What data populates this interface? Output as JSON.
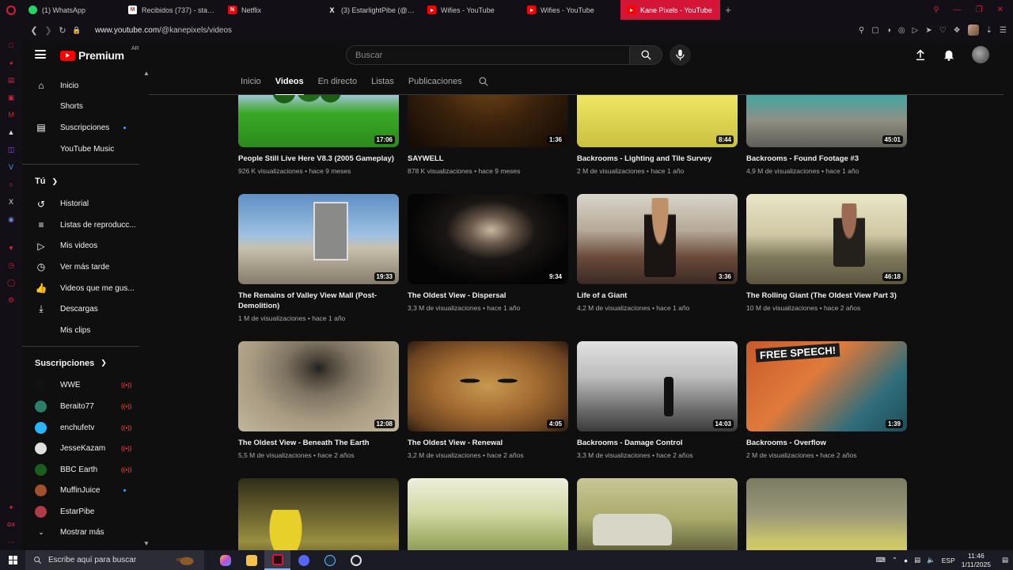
{
  "browser": {
    "tabs": [
      {
        "title": "(1) WhatsApp",
        "favicon": "whatsapp-icon"
      },
      {
        "title": "Recibidos (737) - starlight",
        "favicon": "gmail-icon"
      },
      {
        "title": "Netflix",
        "favicon": "netflix-icon"
      },
      {
        "title": "(3) EstarlightPibe (@Esta",
        "favicon": "x-icon"
      },
      {
        "title": "Wifies - YouTube",
        "favicon": "youtube-icon"
      },
      {
        "title": "Wifies - YouTube",
        "favicon": "youtube-icon"
      },
      {
        "title": "Kane Pixels - YouTube",
        "favicon": "youtube-icon",
        "active": true
      }
    ],
    "url_host": "www.youtube.com",
    "url_path": "/@kanepixels/videos",
    "accent": "#d31638"
  },
  "masthead": {
    "logo_text": "Premium",
    "country_code": "AR",
    "search_placeholder": "Buscar"
  },
  "guide": {
    "main": [
      {
        "label": "Inicio",
        "icon": "home-icon"
      },
      {
        "label": "Shorts",
        "icon": "shorts-icon"
      },
      {
        "label": "Suscripciones",
        "icon": "subscriptions-icon",
        "dot": true
      },
      {
        "label": "YouTube Music",
        "icon": "music-icon"
      }
    ],
    "you_title": "Tú",
    "you": [
      {
        "label": "Historial",
        "icon": "history-icon"
      },
      {
        "label": "Listas de reproducc...",
        "icon": "playlists-icon"
      },
      {
        "label": "Mis videos",
        "icon": "my-videos-icon"
      },
      {
        "label": "Ver más tarde",
        "icon": "watch-later-icon"
      },
      {
        "label": "Videos que me gus...",
        "icon": "liked-icon"
      },
      {
        "label": "Descargas",
        "icon": "download-icon"
      },
      {
        "label": "Mis clips",
        "icon": "clips-icon"
      }
    ],
    "subs_title": "Suscripciones",
    "subs": [
      {
        "label": "WWE",
        "color": "#111111",
        "live": true
      },
      {
        "label": "Beraito77",
        "color": "#2e7d6a",
        "live": true
      },
      {
        "label": "enchufetv",
        "color": "#29b6f6",
        "live": true
      },
      {
        "label": "JesseKazam",
        "color": "#e0e0e0",
        "live": true
      },
      {
        "label": "BBC Earth",
        "color": "#1b5e20",
        "live": true
      },
      {
        "label": "MuffinJuice",
        "color": "#a1502c",
        "dot": true
      },
      {
        "label": "EstarPibe",
        "color": "#b03a48"
      }
    ],
    "show_more": "Mostrar más"
  },
  "channel_tabs": [
    {
      "label": "Inicio"
    },
    {
      "label": "Videos",
      "active": true
    },
    {
      "label": "En directo"
    },
    {
      "label": "Listas"
    },
    {
      "label": "Publicaciones"
    }
  ],
  "videos": [
    {
      "title": "People Still Live Here V8.3 (2005 Gameplay)",
      "meta": "926 K visualizaciones • hace 9 meses",
      "duration": "17:06",
      "thumb": "t-grass"
    },
    {
      "title": "SAYWELL",
      "meta": "878 K visualizaciones • hace 9 meses",
      "duration": "1:36",
      "thumb": "t-dark-amber"
    },
    {
      "title": "Backrooms - Lighting and Tile Survey",
      "meta": "2 M de visualizaciones • hace 1 año",
      "duration": "8:44",
      "thumb": "t-yellow-suits"
    },
    {
      "title": "Backrooms - Found Footage #3",
      "meta": "4,9 M de visualizaciones • hace 1 año",
      "duration": "45:01",
      "thumb": "t-house"
    },
    {
      "title": "The Remains of Valley View Mall (Post-Demolition)",
      "meta": "1 M de visualizaciones • hace 1 año",
      "duration": "19:33",
      "thumb": "t-mall-ruin"
    },
    {
      "title": "The Oldest View - Dispersal",
      "meta": "3,3 M de visualizaciones • hace 1 año",
      "duration": "9:34",
      "thumb": "t-mask-dark"
    },
    {
      "title": "Life of a Giant",
      "meta": "4,2 M de visualizaciones • hace 1 año",
      "duration": "3:36",
      "thumb": "t-mall-crowd"
    },
    {
      "title": "The Rolling Giant (The Oldest View Part 3)",
      "meta": "10 M de visualizaciones • hace 2 años",
      "duration": "46:18",
      "thumb": "t-giant"
    },
    {
      "title": "The Oldest View - Beneath The Earth",
      "meta": "5,5 M de visualizaciones • hace 2 años",
      "duration": "12:08",
      "thumb": "t-stairs"
    },
    {
      "title": "The Oldest View - Renewal",
      "meta": "3,2 M de visualizaciones • hace 2 años",
      "duration": "4:05",
      "thumb": "t-mask-wood"
    },
    {
      "title": "Backrooms - Damage Control",
      "meta": "3,3 M de visualizaciones • hace 2 años",
      "duration": "14:03",
      "thumb": "t-bw-hall"
    },
    {
      "title": "Backrooms - Overflow",
      "meta": "2 M de visualizaciones • hace 2 años",
      "duration": "1:39",
      "thumb": "t-free-speech"
    },
    {
      "title": "",
      "meta": "",
      "duration": "",
      "thumb": "t-hazmat"
    },
    {
      "title": "",
      "meta": "",
      "duration": "",
      "thumb": "t-backrooms-green"
    },
    {
      "title": "",
      "meta": "",
      "duration": "",
      "thumb": "t-car"
    },
    {
      "title": "",
      "meta": "",
      "duration": "",
      "thumb": "t-yellow-table"
    }
  ],
  "taskbar": {
    "search_placeholder": "Escribe aquí para buscar",
    "language": "ESP",
    "time": "11:46",
    "date": "1/11/2025"
  }
}
